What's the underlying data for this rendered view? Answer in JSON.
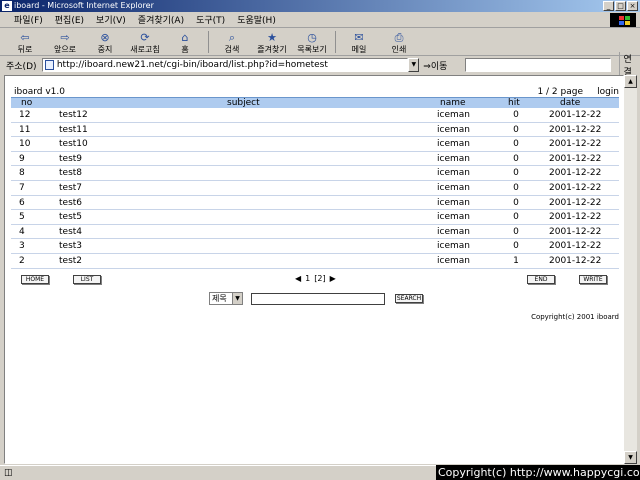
{
  "window": {
    "title": "iboard - Microsoft Internet Explorer"
  },
  "menu": [
    "파일(F)",
    "편집(E)",
    "보기(V)",
    "즐겨찾기(A)",
    "도구(T)",
    "도움말(H)"
  ],
  "toolbar": {
    "back": "뒤로",
    "forward": "앞으로",
    "stop": "중지",
    "refresh": "새로고침",
    "home": "홈",
    "search": "검색",
    "favorites": "즐겨찾기",
    "history": "목록보기",
    "mail": "메일",
    "print": "인쇄"
  },
  "address": {
    "label": "주소(D)",
    "url": "http://iboard.new21.net/cgi-bin/iboard/list.php?id=hometest",
    "go": "이동",
    "links": "연결"
  },
  "board": {
    "version": "iboard v1.0",
    "page_info": "1 / 2 page",
    "login": "login",
    "headers": {
      "no": "no",
      "subject": "subject",
      "name": "name",
      "hit": "hit",
      "date": "date"
    },
    "rows": [
      {
        "no": "12",
        "subject": "test12",
        "name": "iceman",
        "hit": "0",
        "date": "2001-12-22"
      },
      {
        "no": "11",
        "subject": "test11",
        "name": "iceman",
        "hit": "0",
        "date": "2001-12-22"
      },
      {
        "no": "10",
        "subject": "test10",
        "name": "iceman",
        "hit": "0",
        "date": "2001-12-22"
      },
      {
        "no": "9",
        "subject": "test9",
        "name": "iceman",
        "hit": "0",
        "date": "2001-12-22"
      },
      {
        "no": "8",
        "subject": "test8",
        "name": "iceman",
        "hit": "0",
        "date": "2001-12-22"
      },
      {
        "no": "7",
        "subject": "test7",
        "name": "iceman",
        "hit": "0",
        "date": "2001-12-22"
      },
      {
        "no": "6",
        "subject": "test6",
        "name": "iceman",
        "hit": "0",
        "date": "2001-12-22"
      },
      {
        "no": "5",
        "subject": "test5",
        "name": "iceman",
        "hit": "0",
        "date": "2001-12-22"
      },
      {
        "no": "4",
        "subject": "test4",
        "name": "iceman",
        "hit": "0",
        "date": "2001-12-22"
      },
      {
        "no": "3",
        "subject": "test3",
        "name": "iceman",
        "hit": "0",
        "date": "2001-12-22"
      },
      {
        "no": "2",
        "subject": "test2",
        "name": "iceman",
        "hit": "1",
        "date": "2001-12-22"
      }
    ],
    "buttons": {
      "home": "HOME",
      "list": "LIST",
      "end": "END",
      "write": "WRITE",
      "search": "SEARCH"
    },
    "pager": {
      "prev": "◀",
      "current": "1",
      "other": "[2]",
      "next": "▶"
    },
    "search_field": "제목",
    "copyright": "Copyright(c) 2001 iboard"
  },
  "overlay_copyright": "Copyright(c) http://www.happycgi.com"
}
